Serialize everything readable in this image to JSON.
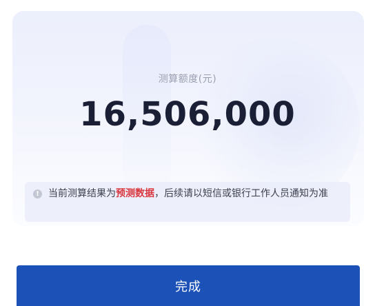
{
  "result": {
    "label": "测算额度(元)",
    "amount": "16,506,000"
  },
  "notice": {
    "icon": "info-icon",
    "prefix": "当前测算结果为",
    "highlight": "预测数据",
    "suffix": "，后续请以短信或银行工作人员通知为准"
  },
  "actions": {
    "done_label": "完成"
  },
  "colors": {
    "primary": "#1c51b8",
    "highlight": "#d9363e",
    "amount_text": "#1b1f36"
  }
}
